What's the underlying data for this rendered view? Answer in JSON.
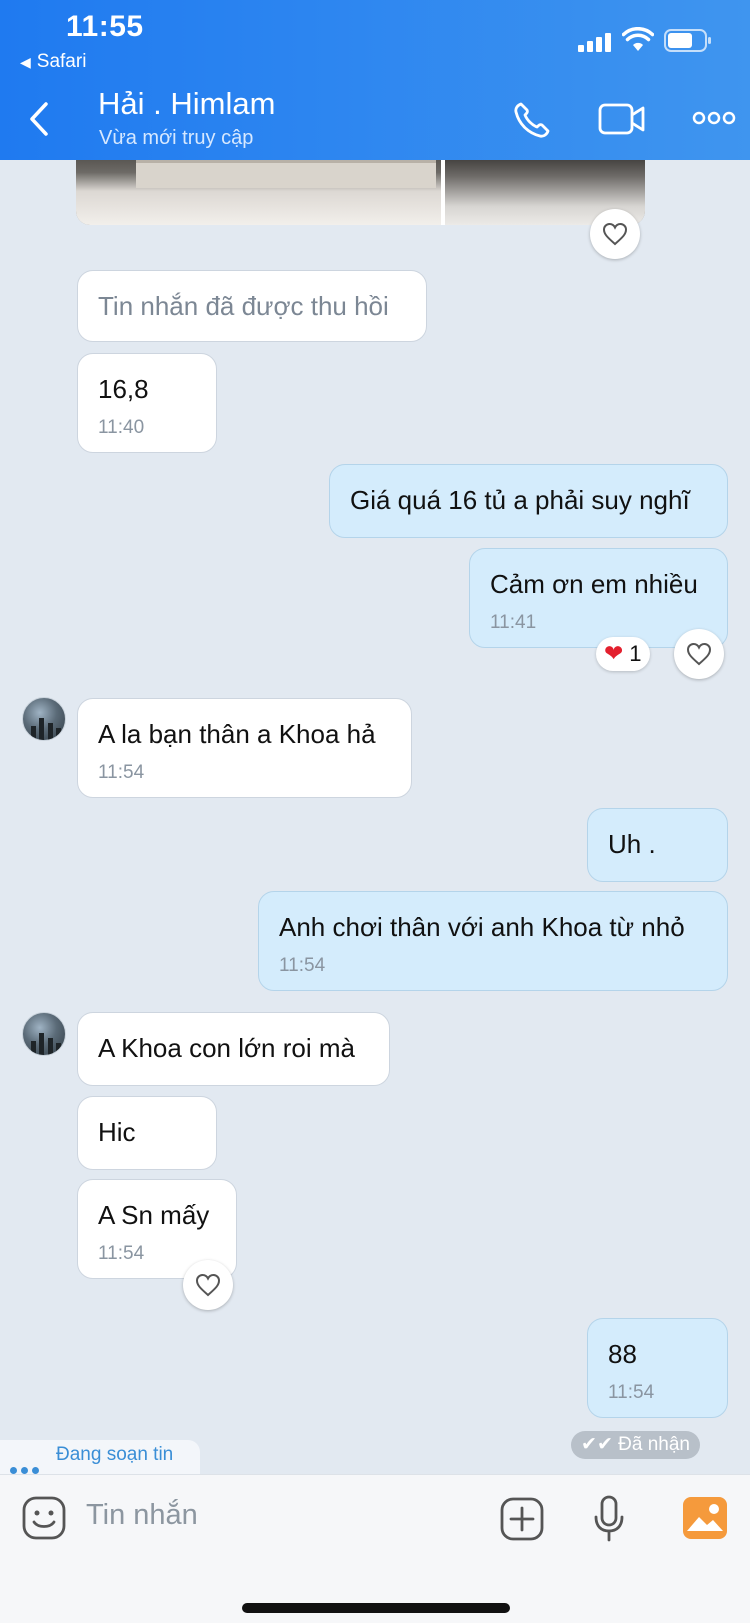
{
  "status_bar": {
    "time": "11:55",
    "back_app": "Safari"
  },
  "header": {
    "contact_name": "Hải . Himlam",
    "contact_status": "Vừa mới truy cập"
  },
  "messages": [
    {
      "id": "m1",
      "text": "Tin nhắn đã được thu hồi"
    },
    {
      "id": "m2",
      "text": "16,8",
      "time": "11:40"
    },
    {
      "id": "m3",
      "text": "Giá quá 16 tủ a phải suy nghĩ"
    },
    {
      "id": "m4",
      "text": "Cảm ơn em nhiều",
      "time": "11:41",
      "reaction_count": "1"
    },
    {
      "id": "m5",
      "text": "A la bạn thân a Khoa hả",
      "time": "11:54"
    },
    {
      "id": "m6",
      "text": "Uh ."
    },
    {
      "id": "m7",
      "text": "Anh chơi thân với anh Khoa từ nhỏ",
      "time": "11:54"
    },
    {
      "id": "m8",
      "text": "A Khoa con lớn roi mà"
    },
    {
      "id": "m9",
      "text": "Hic"
    },
    {
      "id": "m10",
      "text": "A Sn mấy",
      "time": "11:54"
    },
    {
      "id": "m11",
      "text": "88",
      "time": "11:54"
    }
  ],
  "delivery_status": "Đã nhận",
  "typing_indicator": "Đang soạn tin",
  "composer": {
    "placeholder": "Tin nhắn"
  },
  "colors": {
    "header_start": "#1f7af0",
    "header_end": "#3f95ef",
    "outgoing_bubble": "#d4ecfc",
    "incoming_bubble": "#ffffff",
    "chat_background": "#e2e9f1",
    "accent": "#3a8ed6",
    "heart": "#e3202e"
  },
  "icons": [
    "back-icon",
    "phone-icon",
    "video-icon",
    "more-icon",
    "heart-icon",
    "emoji-icon",
    "add-icon",
    "mic-icon",
    "image-icon"
  ]
}
